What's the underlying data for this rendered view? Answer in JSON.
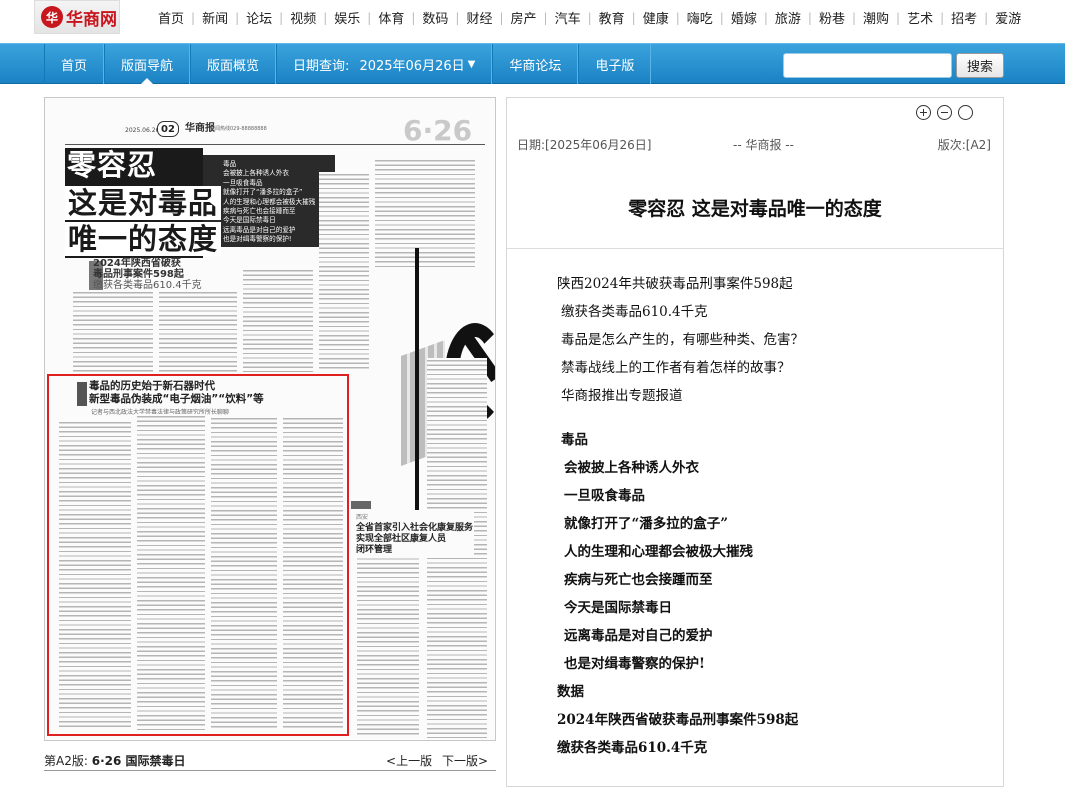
{
  "logo": {
    "mark": "华",
    "text": "华商网"
  },
  "top_nav": [
    "首页",
    "新闻",
    "论坛",
    "视频",
    "娱乐",
    "体育",
    "数码",
    "财经",
    "房产",
    "汽车",
    "教育",
    "健康",
    "嗨吃",
    "婚嫁",
    "旅游",
    "粉巷",
    "潮购",
    "艺术",
    "招考",
    "爱游"
  ],
  "blue_nav": {
    "home": "首页",
    "layout_nav": "版面导航",
    "overview": "版面概览",
    "date_label": "日期查询:",
    "date_value": "2025年06月26日",
    "forum": "华商论坛",
    "epaper": "电子版"
  },
  "search": {
    "placeholder": "",
    "button": "搜索"
  },
  "paper": {
    "page_num": "02",
    "brand": "华商报",
    "date_line": "2025.06.26  星期四",
    "info_line": "新闻热线029-88888888",
    "big_date": "6·26",
    "headline": [
      "零容忍",
      "这是对毒品",
      "唯一的态度"
    ],
    "taglines": [
      "毒品",
      "会被披上各种诱人外衣",
      "一旦吸食毒品",
      "就像打开了“潘多拉的盒子”",
      "人的生理和心理都会被极大摧残",
      "疾病与死亡也会接踵而至",
      "今天是国际禁毒日",
      "远离毒品是对自己的爱护",
      "也是对缉毒警察的保护!"
    ],
    "sub_title": [
      "2024年陕西省破获",
      "毒品刑事案件598起",
      "缴获各类毒品610.4千克"
    ],
    "article_title": [
      "毒品的历史始于新石器时代",
      "新型毒品伪装成“电子烟油”“饮料”等"
    ],
    "article_sub": "记者与西北政法大学禁毒法律与政策研究所所长聊聊",
    "right_title": [
      "全省首家引入社会化康复服务",
      "实现全部社区康复人员",
      "闭环管理"
    ],
    "right_small": "西安"
  },
  "paper_footer": {
    "page_label": "第A2版:",
    "page_name": "6·26 国际禁毒日",
    "prev": "<上一版",
    "next": "下一版>"
  },
  "article": {
    "date": "日期:[2025年06月26日]",
    "source": "-- 华商报 --",
    "page": "版次:[A2]",
    "title": "零容忍 这是对毒品唯一的态度",
    "lines": [
      {
        "text": "陕西2024年共破获毒品刑事案件598起",
        "style": "ind0"
      },
      {
        "text": "缴获各类毒品610.4千克",
        "style": "ind1"
      },
      {
        "text": "毒品是怎么产生的，有哪些种类、危害？",
        "style": "ind1"
      },
      {
        "text": "禁毒战线上的工作者有着怎样的故事？",
        "style": "ind1"
      },
      {
        "text": "华商报推出专题报道",
        "style": "ind1"
      }
    ],
    "bold_lines": [
      {
        "text": "毒品",
        "style": "ind1"
      },
      {
        "text": "会被披上各种诱人外衣",
        "style": "ind2"
      },
      {
        "text": "一旦吸食毒品",
        "style": "ind2"
      },
      {
        "text": "就像打开了“潘多拉的盒子”",
        "style": "ind2"
      },
      {
        "text": "人的生理和心理都会被极大摧残",
        "style": "ind2"
      },
      {
        "text": "疾病与死亡也会接踵而至",
        "style": "ind2"
      },
      {
        "text": "今天是国际禁毒日",
        "style": "ind2"
      },
      {
        "text": "远离毒品是对自己的爱护",
        "style": "ind2"
      },
      {
        "text": "也是对缉毒警察的保护!",
        "style": "ind2"
      },
      {
        "text": "数据",
        "style": "ind0"
      },
      {
        "text": "2024年陕西省破获毒品刑事案件598起",
        "style": "ind0"
      },
      {
        "text": "缴获各类毒品610.4千克",
        "style": "ind0"
      }
    ]
  },
  "colors": {
    "accent_blue": "#1b83c4",
    "highlight_red": "#e02020",
    "brand_red": "#c8161d"
  }
}
